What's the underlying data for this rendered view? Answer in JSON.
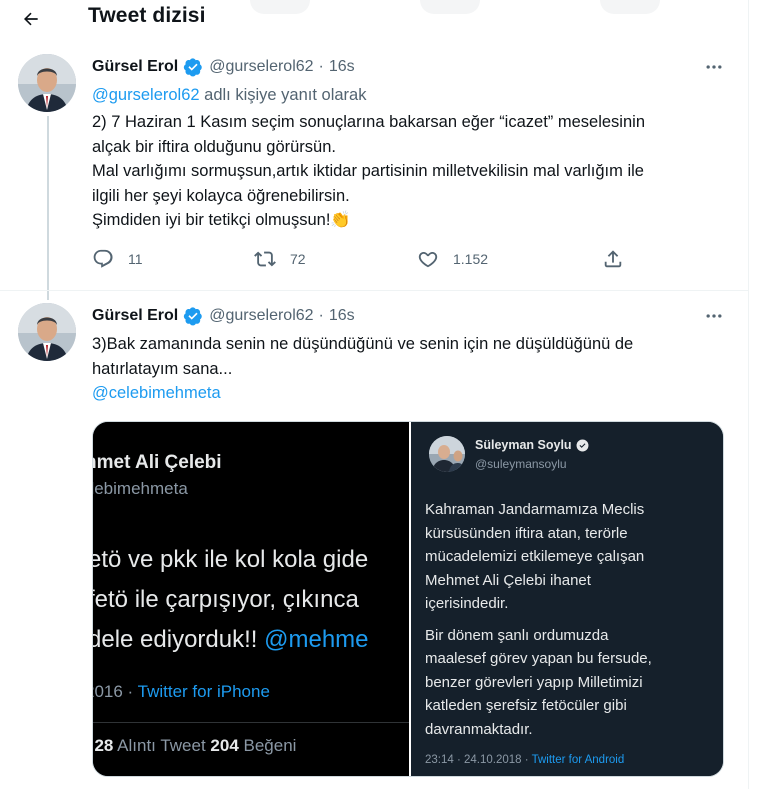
{
  "header": {
    "title": "Tweet dizisi",
    "back_icon": "arrow-left-icon"
  },
  "tweets": [
    {
      "author": "Gürsel Erol",
      "handle": "@gurselerol62",
      "separator": "·",
      "time": "16s",
      "reply_to_handle": "@gurselerol62",
      "reply_to_suffix": " adlı kişiye yanıt olarak",
      "lines": [
        "2) 7 Haziran 1 Kasım seçim sonuçlarına bakarsan eğer “icazet” meselesinin",
        "alçak bir iftira olduğunu görürsün.",
        "Mal varlığımı sormuşsun,artık iktidar partisinin milletvekilisin mal varlığım ile",
        "ilgili her şeyi kolayca öğrenebilirsin.",
        "Şimdiden iyi bir tetikçi olmuşsun!"
      ],
      "emoji": "👏",
      "stats": {
        "replies": "11",
        "retweets": "72",
        "likes": "1.152"
      }
    },
    {
      "author": "Gürsel Erol",
      "handle": "@gurselerol62",
      "separator": "·",
      "time": "16s",
      "lines": [
        "3)Bak zamanında senin ne düşündüğünü ve senin için ne düşüldüğünü de",
        "hatırlatayım sana..."
      ],
      "mention": "@celebimehmeta"
    }
  ],
  "media": {
    "left": {
      "name": "hmet Ali Çelebi",
      "handle": "elebimehmeta",
      "lines": [
        "etö ve pkk ile kol kola gide",
        " fetö ile çarpışıyor, çıkınca",
        "dele ediyorduk!! "
      ],
      "mention_fragment": "@mehme",
      "meta_date": "2016",
      "meta_sep": " · ",
      "meta_source": "Twitter for iPhone",
      "stats_prefix": "t ",
      "quote_count": "28",
      "quote_label": " Alıntı Tweet ",
      "like_count": "204",
      "like_label": " Beğeni"
    },
    "right": {
      "name": "Süleyman Soylu",
      "handle": "@suleymansoylu",
      "paragraph1": [
        "Kahraman Jandarmamıza Meclis",
        "kürsüsünden iftira atan, terörle",
        "mücadelemizi etkilemeye çalışan",
        "Mehmet Ali Çelebi ihanet",
        "içerisindedir."
      ],
      "paragraph2": [
        "Bir dönem şanlı ordumuzda",
        "maalesef görev yapan bu fersude,",
        "benzer görevleri yapıp Milletimizi",
        "katleden şerefsiz fetöcüler gibi",
        "davranmaktadır."
      ],
      "meta_time": "23:14 · 24.10.2018 · ",
      "meta_source": "Twitter for Android"
    }
  },
  "colors": {
    "accent": "#1d9bf0",
    "text": "#0f1419",
    "secondary": "#536471",
    "verified": "#1d9bf0",
    "dark_card": "#15202b"
  }
}
